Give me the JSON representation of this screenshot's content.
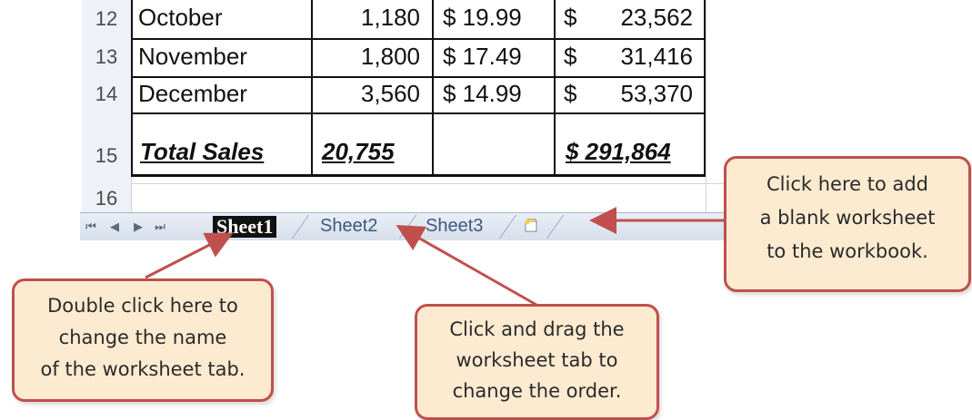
{
  "rows": [
    {
      "num": "12",
      "month": "October",
      "units": "1,180",
      "price": "$ 19.99",
      "sales_sym": "$",
      "sales": "23,562"
    },
    {
      "num": "13",
      "month": "November",
      "units": "1,800",
      "price": "$ 17.49",
      "sales_sym": "$",
      "sales": "31,416"
    },
    {
      "num": "14",
      "month": "December",
      "units": "3,560",
      "price": "$ 14.99",
      "sales_sym": "$",
      "sales": "53,370"
    }
  ],
  "total_row": {
    "num": "15",
    "label": "Total Sales",
    "units": "20,755",
    "sales": "$ 291,864"
  },
  "empty_row": {
    "num": "16"
  },
  "tabs": {
    "active": "Sheet1",
    "others": [
      "Sheet2",
      "Sheet3"
    ],
    "insert_icon": "insert-worksheet-icon",
    "nav_icons": [
      "first-sheet-icon",
      "prev-sheet-icon",
      "next-sheet-icon",
      "last-sheet-icon"
    ]
  },
  "callouts": {
    "rename": [
      "Double click here to",
      "change the name",
      "of the worksheet tab."
    ],
    "drag": [
      "Click and drag the",
      "worksheet tab to",
      "change the order."
    ],
    "add": [
      "Click here to add",
      "a blank worksheet",
      "to the workbook."
    ]
  },
  "colors": {
    "callout_bg": "#fdebd1",
    "callout_border": "#c0504d",
    "arrow": "#c0504d",
    "active_tab": "#111111"
  }
}
